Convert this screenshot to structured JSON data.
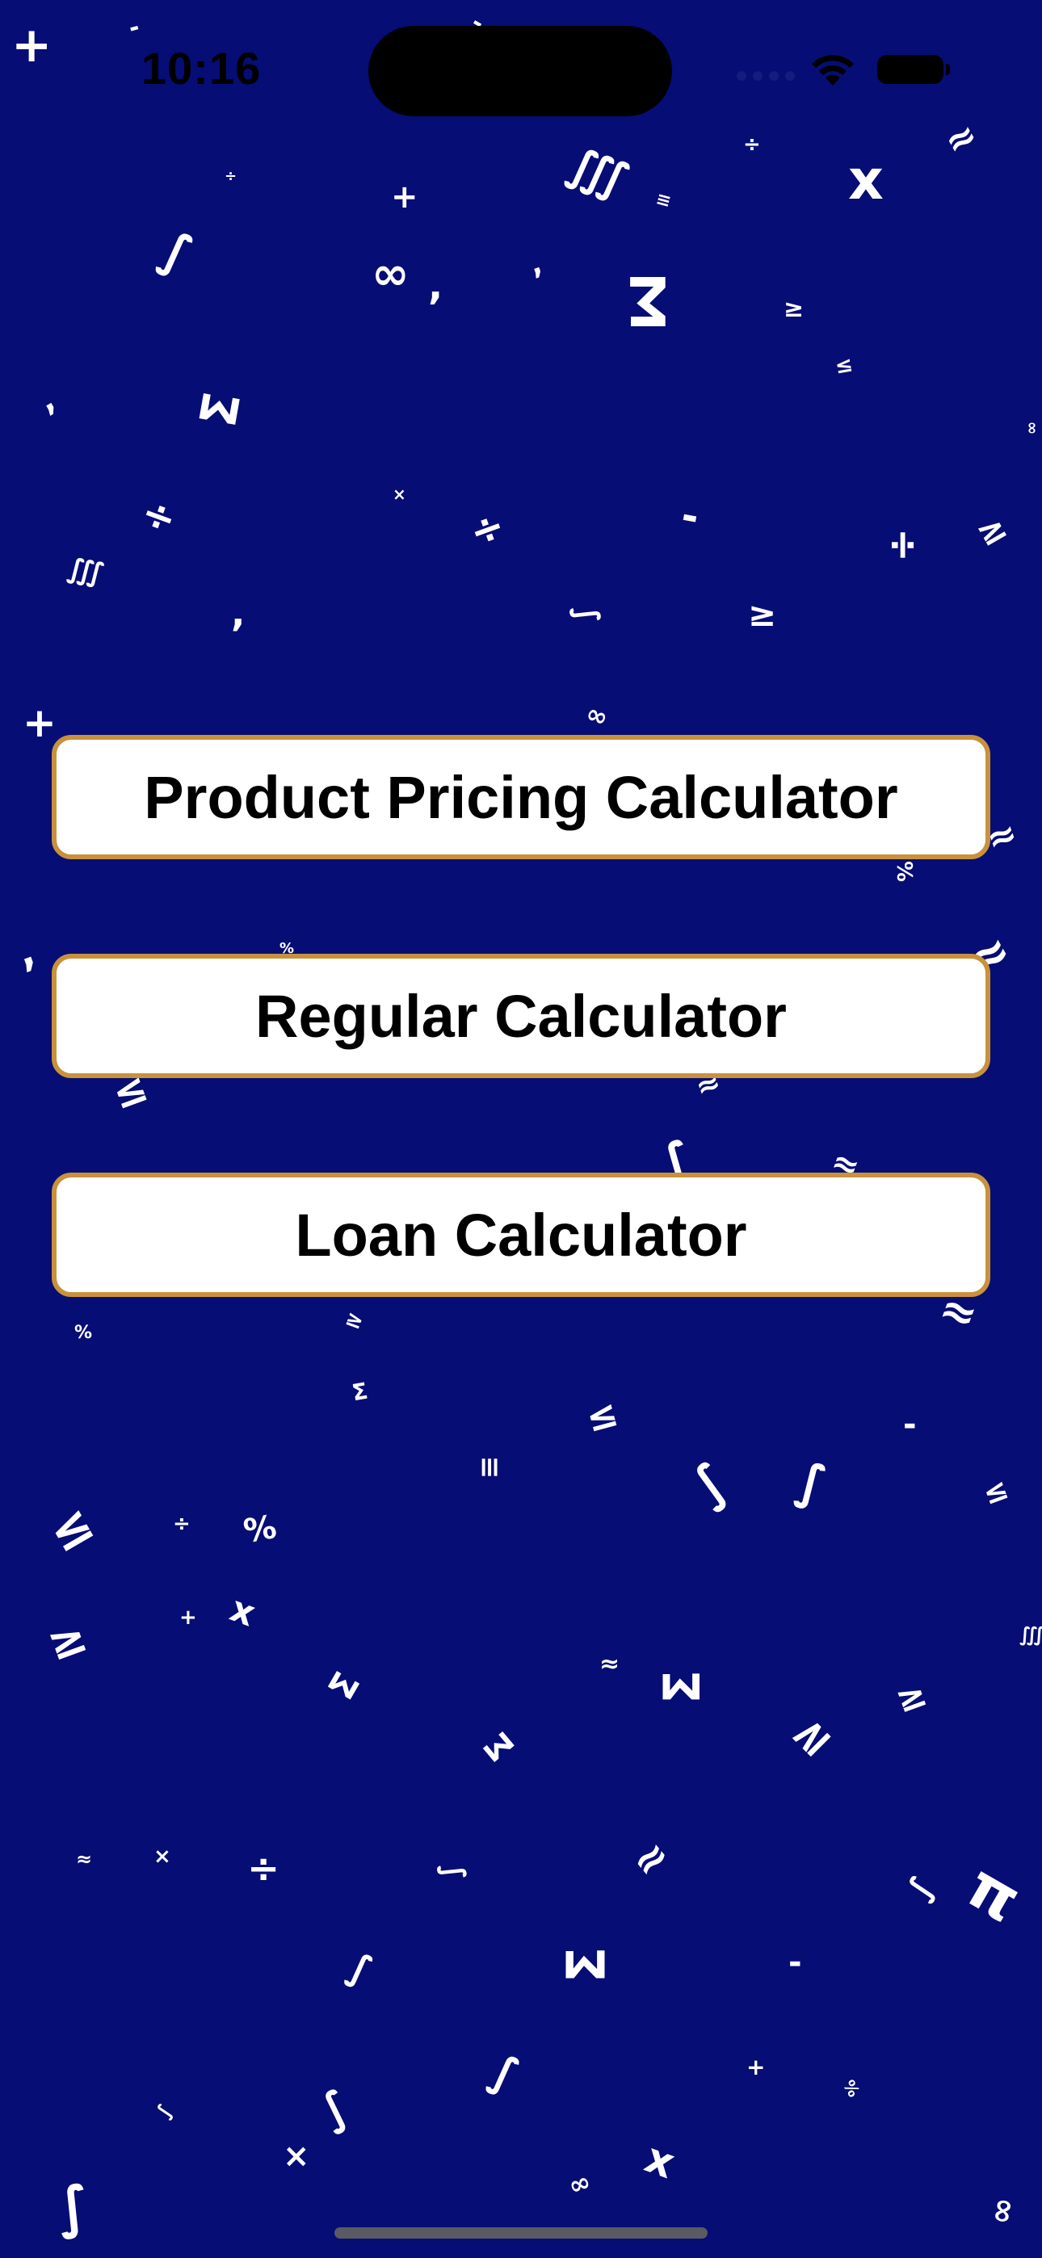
{
  "status_bar": {
    "time": "10:16"
  },
  "background_color": "#060d74",
  "button_border_color": "#c8913c",
  "menu": {
    "buttons": [
      {
        "label": "Product Pricing Calculator"
      },
      {
        "label": "Regular Calculator"
      },
      {
        "label": "Loan Calculator"
      }
    ]
  },
  "decor": {
    "plus": "+",
    "times": "×",
    "x": "x",
    "divide": "÷",
    "percent": "%",
    "infinity": "∞",
    "integral": "∫",
    "triple_integral": "∭",
    "sigma": "Σ",
    "pi": "π",
    "approx": "≈",
    "geq": "≥",
    "leq": "≤",
    "minus": "-",
    "comma": ",",
    "identical": "≡"
  },
  "icons": {
    "wifi": "wifi-icon",
    "battery": "battery-icon",
    "signal": "cellular-signal-icon"
  }
}
